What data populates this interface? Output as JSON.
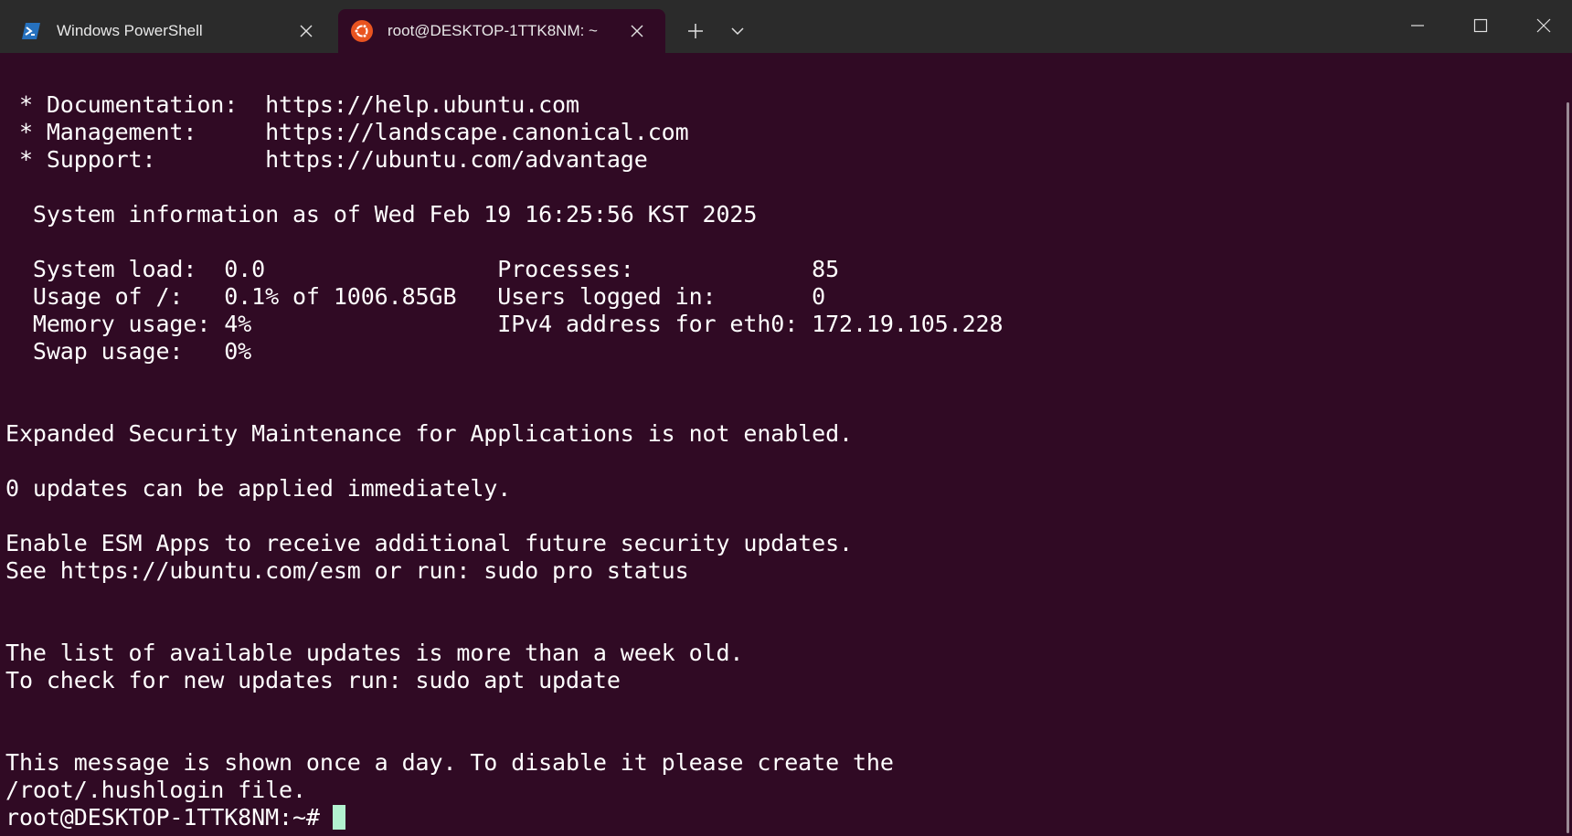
{
  "tabs": [
    {
      "label": "Windows PowerShell",
      "icon": "powershell-icon",
      "active": false
    },
    {
      "label": "root@DESKTOP-1TTK8NM: ~",
      "icon": "ubuntu-icon",
      "active": true
    }
  ],
  "toolbar": {
    "new_tab_icon": "plus-icon",
    "dropdown_icon": "chevron-down-icon"
  },
  "window_controls": [
    "minimize-icon",
    "maximize-icon",
    "close-icon"
  ],
  "terminal": {
    "lines": [
      " * Documentation:  https://help.ubuntu.com",
      " * Management:     https://landscape.canonical.com",
      " * Support:        https://ubuntu.com/advantage",
      "",
      "  System information as of Wed Feb 19 16:25:56 KST 2025",
      "",
      "  System load:  0.0                 Processes:             85",
      "  Usage of /:   0.1% of 1006.85GB   Users logged in:       0",
      "  Memory usage: 4%                  IPv4 address for eth0: 172.19.105.228",
      "  Swap usage:   0%",
      "",
      "",
      "Expanded Security Maintenance for Applications is not enabled.",
      "",
      "0 updates can be applied immediately.",
      "",
      "Enable ESM Apps to receive additional future security updates.",
      "See https://ubuntu.com/esm or run: sudo pro status",
      "",
      "",
      "The list of available updates is more than a week old.",
      "To check for new updates run: sudo apt update",
      "",
      "",
      "This message is shown once a day. To disable it please create the",
      "/root/.hushlogin file."
    ],
    "prompt": "root@DESKTOP-1TTK8NM:~#"
  },
  "colors": {
    "terminal_bg": "#300a24",
    "titlebar_bg": "#2b2b2b",
    "cursor": "#b3f2d0",
    "ubuntu_orange": "#e95420",
    "powershell_blue": "#2671be"
  }
}
